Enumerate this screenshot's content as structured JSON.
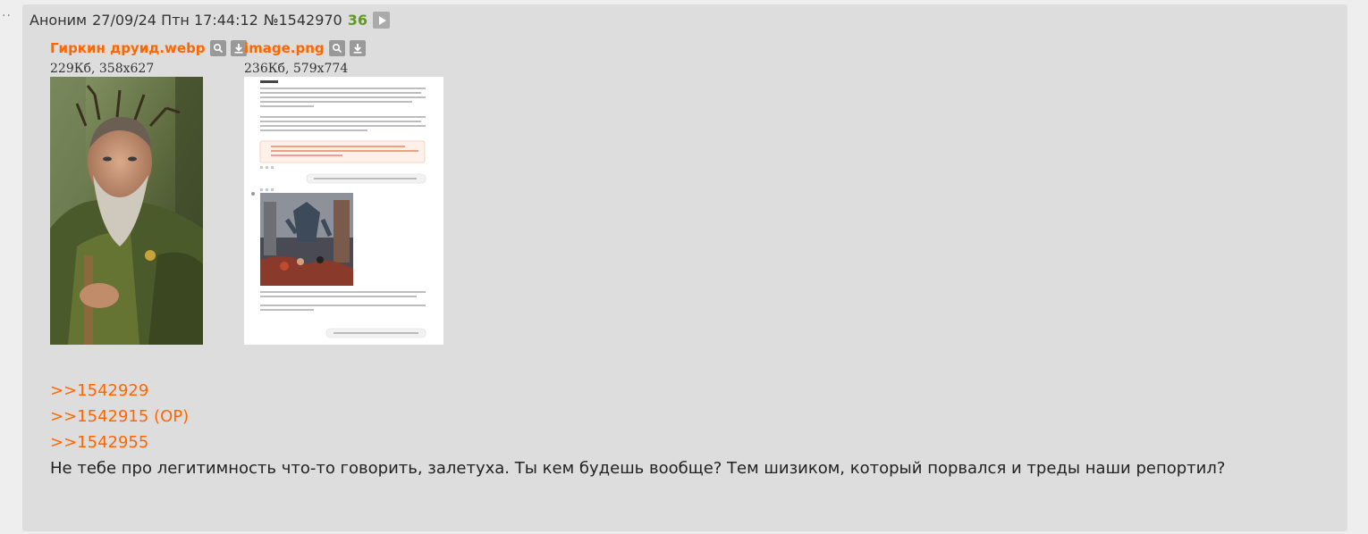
{
  "post": {
    "name": "Аноним",
    "date": "27/09/24 Птн 17:44:12",
    "number": "№1542970",
    "reply_count": "36"
  },
  "files": [
    {
      "name": "Гиркин друид.webp",
      "meta": "229Кб, 358x627"
    },
    {
      "name": "image.png",
      "meta": "236Кб, 579x774"
    }
  ],
  "refs": [
    "&gt;&gt;1542929",
    "&gt;&gt;1542915 (OP)",
    "&gt;&gt;1542955"
  ],
  "refs_text": [
    ">>1542929",
    ">>1542915 (OP)",
    ">>1542955"
  ],
  "message": "Не тебе про легитимность что-то говорить, залетуха. Ты кем будешь вообще? Тем шизиком, который порвался и треды наши репортил?",
  "icons": [
    "search-icon",
    "download-icon",
    "play-icon"
  ]
}
